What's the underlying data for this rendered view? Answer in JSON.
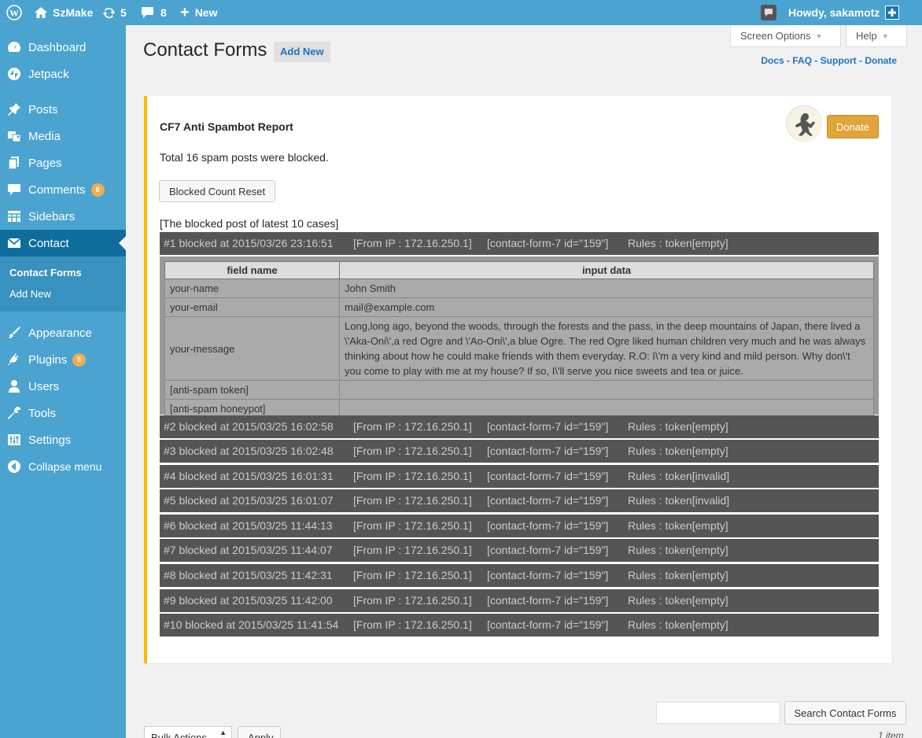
{
  "adminbar": {
    "site_name": "SzMake",
    "updates_count": "5",
    "comments_count": "8",
    "new_label": "New",
    "howdy": "Howdy, sakamotz"
  },
  "sidebar": {
    "items": [
      {
        "label": "Dashboard",
        "icon": "dashboard-icon"
      },
      {
        "label": "Jetpack",
        "icon": "jetpack-icon"
      },
      {
        "label": "Posts",
        "icon": "pin-icon"
      },
      {
        "label": "Media",
        "icon": "media-icon"
      },
      {
        "label": "Pages",
        "icon": "pages-icon"
      },
      {
        "label": "Comments",
        "icon": "comment-icon",
        "badge": "8"
      },
      {
        "label": "Sidebars",
        "icon": "grid-icon"
      },
      {
        "label": "Contact",
        "icon": "envelope-icon"
      },
      {
        "label": "Appearance",
        "icon": "brush-icon"
      },
      {
        "label": "Plugins",
        "icon": "plug-icon",
        "badge": "5"
      },
      {
        "label": "Users",
        "icon": "user-icon"
      },
      {
        "label": "Tools",
        "icon": "wrench-icon"
      },
      {
        "label": "Settings",
        "icon": "settings-icon"
      },
      {
        "label": "Collapse menu",
        "icon": "collapse-icon"
      }
    ],
    "submenu": [
      "Contact Forms",
      "Add New"
    ]
  },
  "header": {
    "title": "Contact Forms",
    "add_new": "Add New",
    "screen_options": "Screen Options",
    "help": "Help",
    "links": "Docs - FAQ - Support - Donate"
  },
  "report": {
    "title": "CF7 Anti Spambot Report",
    "donate": "Donate",
    "total": "Total 16 spam posts were blocked.",
    "reset_button": "Blocked Count Reset",
    "caption": "[The blocked post of latest 10 cases]",
    "rows": [
      {
        "id": "#1 blocked at 2015/03/26 23:16:51",
        "ip": "[From IP : 172.16.250.1]",
        "form": "[contact-form-7 id=\"159\"]",
        "rule": "Rules : token[empty]"
      },
      {
        "id": "#2 blocked at 2015/03/25 16:02:58",
        "ip": "[From IP : 172.16.250.1]",
        "form": "[contact-form-7 id=\"159\"]",
        "rule": "Rules : token[empty]"
      },
      {
        "id": "#3 blocked at 2015/03/25 16:02:48",
        "ip": "[From IP : 172.16.250.1]",
        "form": "[contact-form-7 id=\"159\"]",
        "rule": "Rules : token[empty]"
      },
      {
        "id": "#4 blocked at 2015/03/25 16:01:31",
        "ip": "[From IP : 172.16.250.1]",
        "form": "[contact-form-7 id=\"159\"]",
        "rule": "Rules : token[invalid]"
      },
      {
        "id": "#5 blocked at 2015/03/25 16:01:07",
        "ip": "[From IP : 172.16.250.1]",
        "form": "[contact-form-7 id=\"159\"]",
        "rule": "Rules : token[invalid]"
      },
      {
        "id": "#6 blocked at 2015/03/25 11:44:13",
        "ip": "[From IP : 172.16.250.1]",
        "form": "[contact-form-7 id=\"159\"]",
        "rule": "Rules : token[empty]"
      },
      {
        "id": "#7 blocked at 2015/03/25 11:44:07",
        "ip": "[From IP : 172.16.250.1]",
        "form": "[contact-form-7 id=\"159\"]",
        "rule": "Rules : token[empty]"
      },
      {
        "id": "#8 blocked at 2015/03/25 11:42:31",
        "ip": "[From IP : 172.16.250.1]",
        "form": "[contact-form-7 id=\"159\"]",
        "rule": "Rules : token[empty]"
      },
      {
        "id": "#9 blocked at 2015/03/25 11:42:00",
        "ip": "[From IP : 172.16.250.1]",
        "form": "[contact-form-7 id=\"159\"]",
        "rule": "Rules : token[empty]"
      },
      {
        "id": "#10 blocked at 2015/03/25 11:41:54",
        "ip": "[From IP : 172.16.250.1]",
        "form": "[contact-form-7 id=\"159\"]",
        "rule": "Rules : token[empty]"
      }
    ],
    "detail": {
      "headers": [
        "field name",
        "input data"
      ],
      "rows": [
        [
          "your-name",
          "John Smith"
        ],
        [
          "your-email",
          "mail@example.com"
        ],
        [
          "your-message",
          "Long,long ago, beyond the woods, through the forests and the pass, in the deep mountains of Japan, there lived a \\'Aka-Oni\\',a red Ogre and \\'Ao-Oni\\',a blue Ogre. The red Ogre liked human children very much and he was always thinking about how he could make friends with them everyday. R.O: I\\'m a very kind and mild person. Why don\\'t you come to play with me at my house? If so, I\\'ll serve you nice sweets and tea or juice."
        ],
        [
          "[anti-spam token]",
          ""
        ],
        [
          "[anti-spam honeypot]",
          ""
        ]
      ]
    }
  },
  "bottom": {
    "search_button": "Search Contact Forms",
    "bulk_actions": "Bulk Actions",
    "apply": "Apply",
    "items": "1 item"
  }
}
